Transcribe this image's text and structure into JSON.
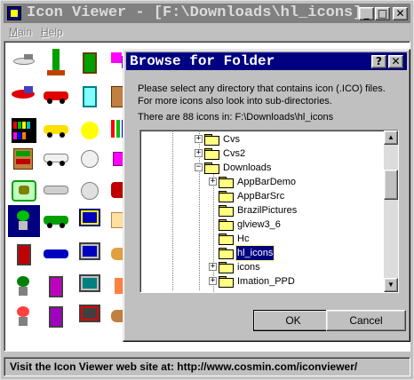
{
  "main_window": {
    "title": "Icon Viewer - [F:\\Downloads\\hl_icons]",
    "minimize": "_",
    "maximize": "□",
    "close": "✕",
    "menu": [
      "Main",
      "Help"
    ],
    "status": "Visit the Icon Viewer web site at:  http://www.cosmin.com/iconviewer/"
  },
  "dialog": {
    "title": "Browse for Folder",
    "help_button": "?",
    "close_button": "✕",
    "instruction_line1": "Please select any directory that contains icon (.ICO) files.",
    "instruction_line2": "For more icons also look into sub-directories.",
    "count_text": "There are 88 icons in: F:\\Downloads\\hl_icons",
    "tree": [
      {
        "label": "Cvs",
        "expander": "+",
        "level": 0
      },
      {
        "label": "Cvs2",
        "expander": "+",
        "level": 0
      },
      {
        "label": "Downloads",
        "expander": "−",
        "level": 0
      },
      {
        "label": "AppBarDemo",
        "expander": "+",
        "level": 1
      },
      {
        "label": "AppBarSrc",
        "expander": "",
        "level": 1
      },
      {
        "label": "BrazilPictures",
        "expander": "",
        "level": 1
      },
      {
        "label": "glview3_6",
        "expander": "",
        "level": 1
      },
      {
        "label": "Hc",
        "expander": "",
        "level": 1
      },
      {
        "label": "hl_icons",
        "expander": "",
        "level": 1,
        "selected": true
      },
      {
        "label": "icons",
        "expander": "+",
        "level": 1
      },
      {
        "label": "Imation_PPD",
        "expander": "+",
        "level": 1
      }
    ],
    "ok_label": "OK",
    "cancel_label": "Cancel"
  },
  "colors": {
    "title_active": "#000080",
    "title_inactive": "#808080",
    "face": "#c0c0c0",
    "selection": "#000080"
  }
}
